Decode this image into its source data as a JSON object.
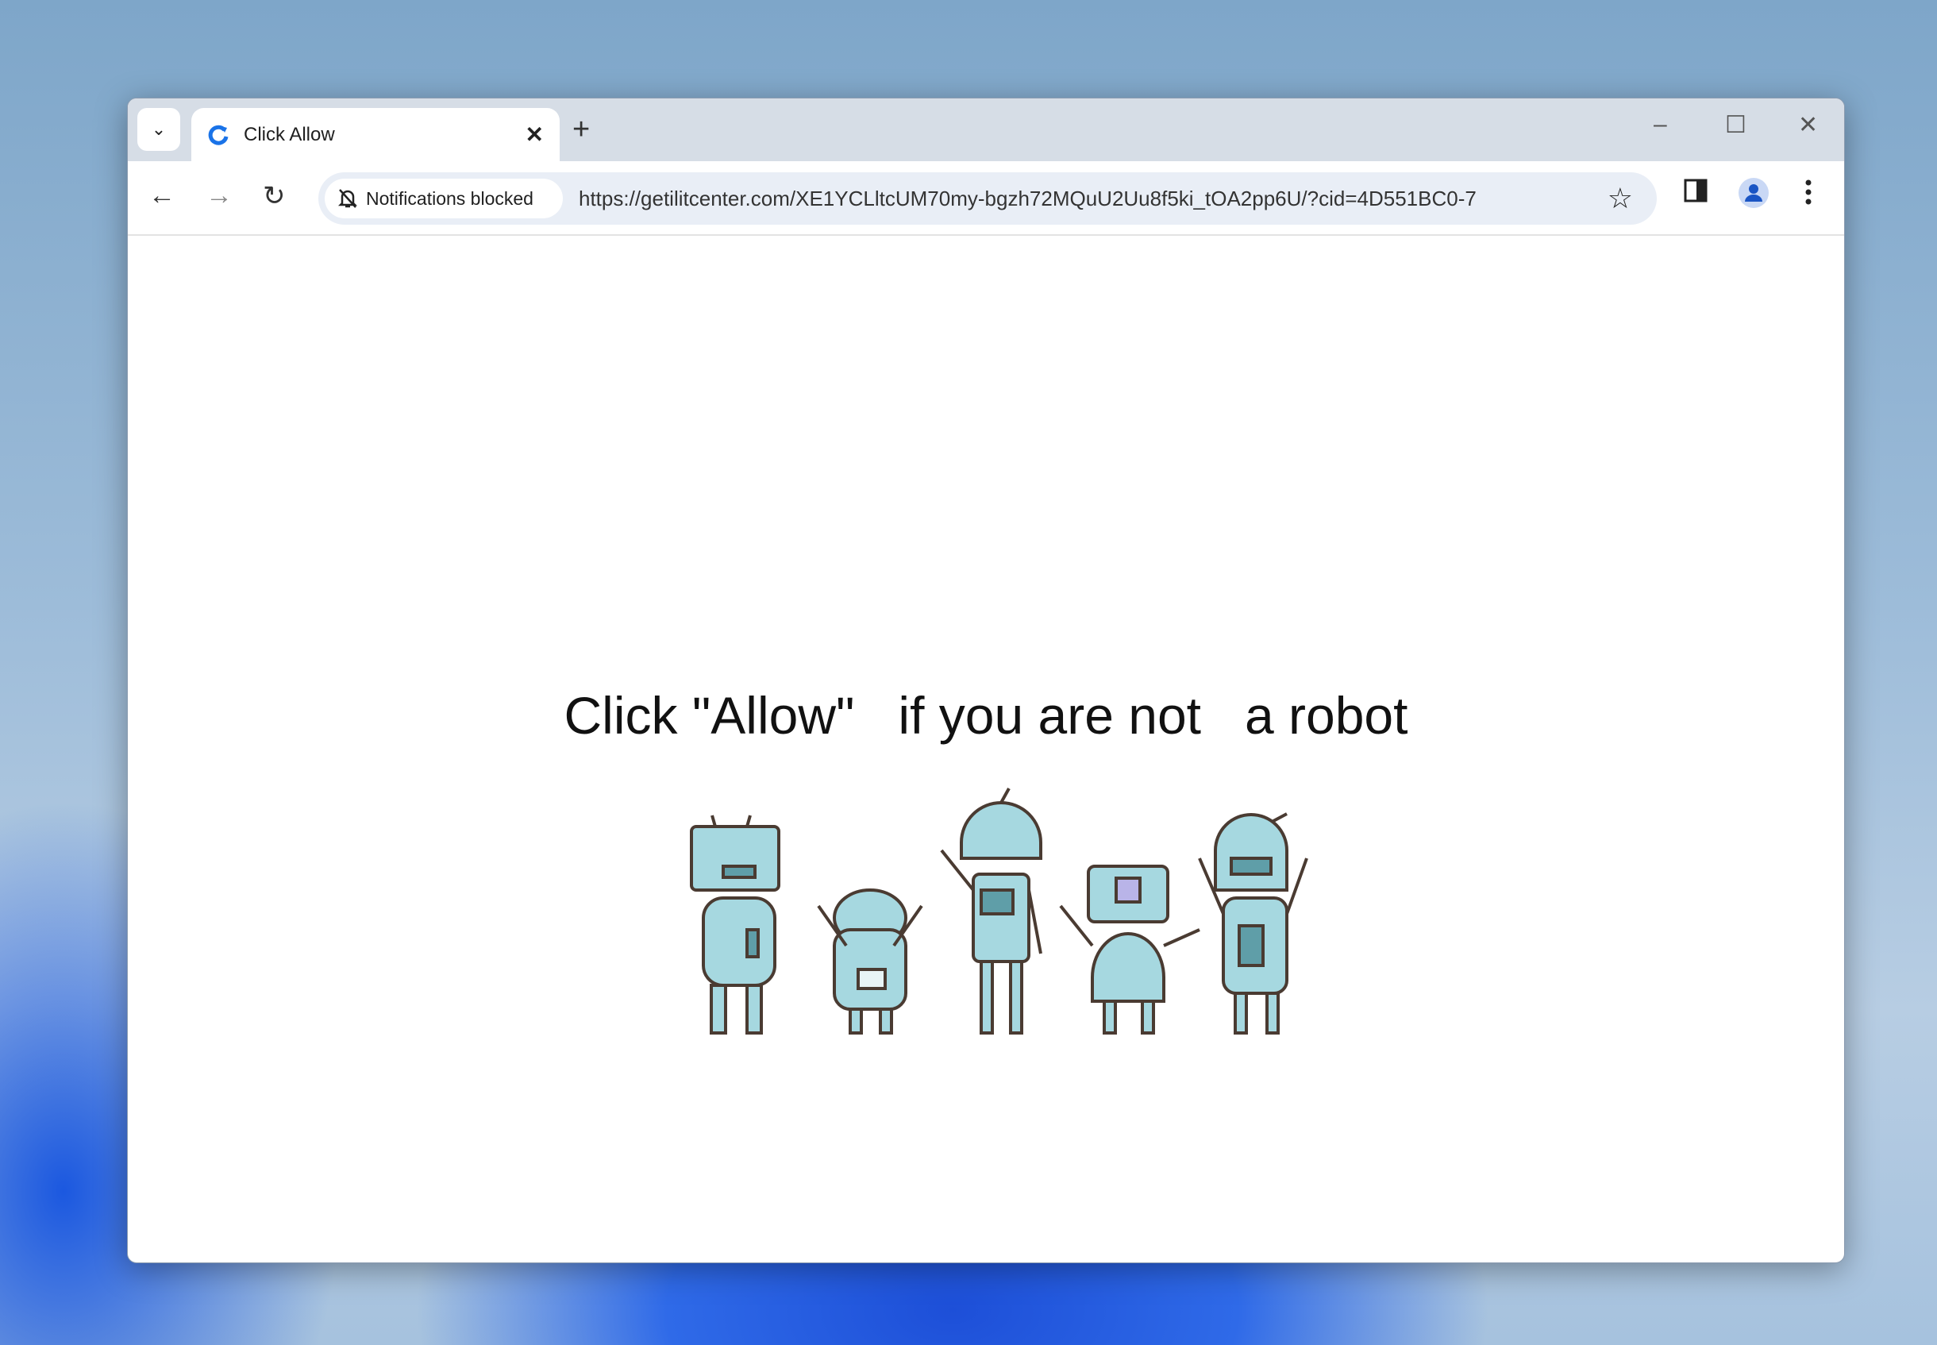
{
  "browser": {
    "tab": {
      "title": "Click Allow",
      "close": "✕"
    },
    "new_tab": "+",
    "window_controls": {
      "minimize": "–",
      "maximize": "☐",
      "close": "✕"
    },
    "nav": {
      "back": "←",
      "forward": "→",
      "reload": "↻"
    },
    "chip_label": "Notifications blocked",
    "url": "https://getilitcenter.com/XE1YCLltcUM70my-bgzh72MQuU2Uu8f5ki_tOA2pp6U/?cid=4D551BC0-7",
    "star": "☆"
  },
  "page": {
    "headline": "Click \"Allow\"   if you are not   a robot"
  },
  "colors": {
    "robot_fill": "#a6d8e0",
    "robot_outline": "#4a3b32",
    "accent": "#1a73e8"
  }
}
